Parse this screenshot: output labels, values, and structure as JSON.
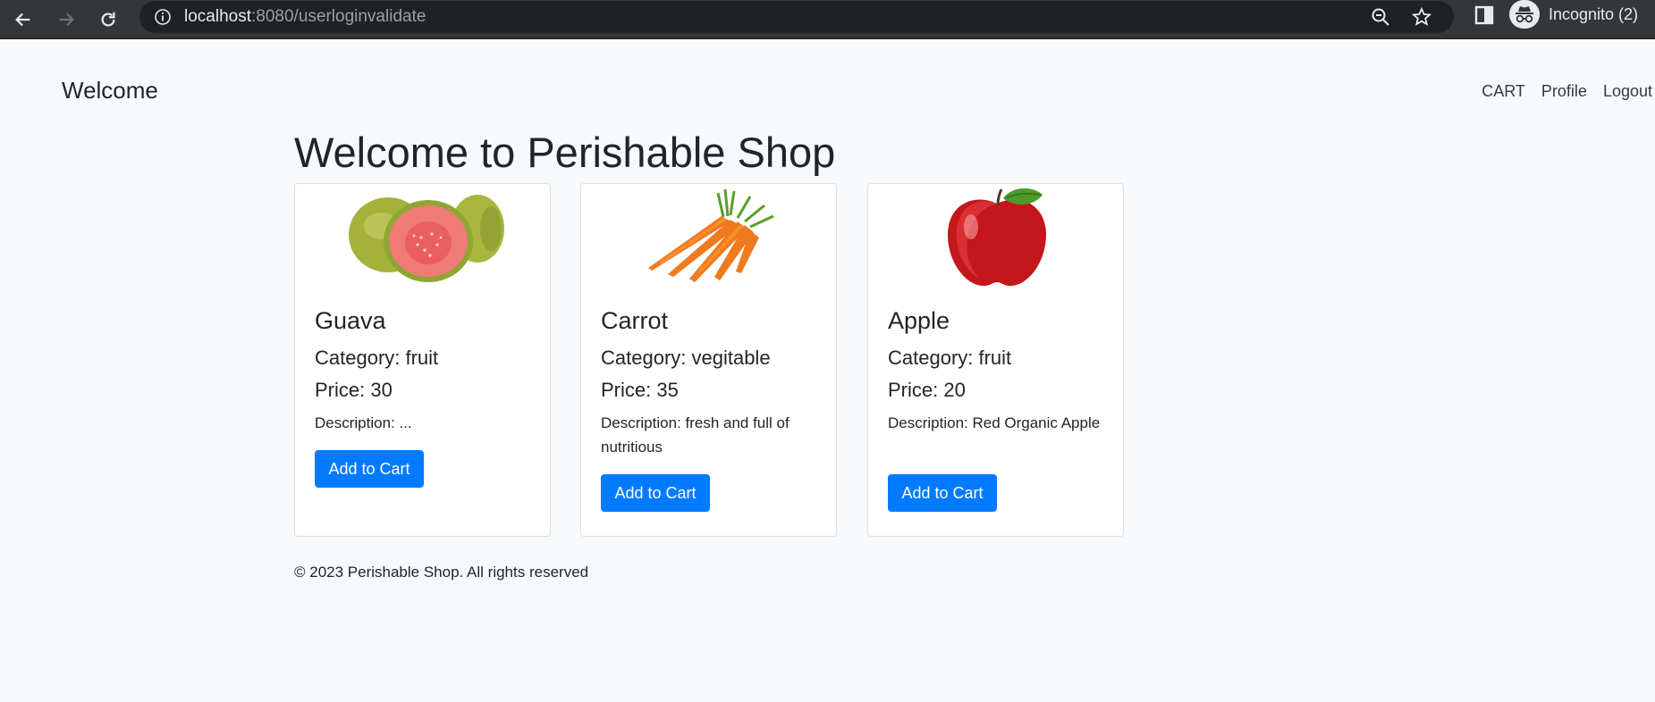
{
  "browser": {
    "url_host": "localhost",
    "url_rest": ":8080/userloginvalidate",
    "profile_label": "Incognito (2)"
  },
  "nav": {
    "brand": "Welcome",
    "links": [
      "CART",
      "Profile",
      "Logout"
    ]
  },
  "heading": "Welcome to Perishable Shop",
  "products": [
    {
      "name": "Guava",
      "category": "Category: fruit",
      "price": "Price: 30",
      "description": "Description: ...",
      "button": "Add to Cart",
      "image": "guava-image"
    },
    {
      "name": "Carrot",
      "category": "Category: vegitable",
      "price": "Price: 35",
      "description": "Description: fresh and full of nutritious",
      "button": "Add to Cart",
      "image": "carrot-image"
    },
    {
      "name": "Apple",
      "category": "Category: fruit",
      "price": "Price: 20",
      "description": "Description: Red Organic Apple",
      "button": "Add to Cart",
      "image": "apple-image"
    }
  ],
  "footer": "© 2023 Perishable Shop. All rights reserved",
  "colors": {
    "primary": "#007bff",
    "page_bg": "#f8f9fa",
    "chrome_bg": "#35363a"
  }
}
